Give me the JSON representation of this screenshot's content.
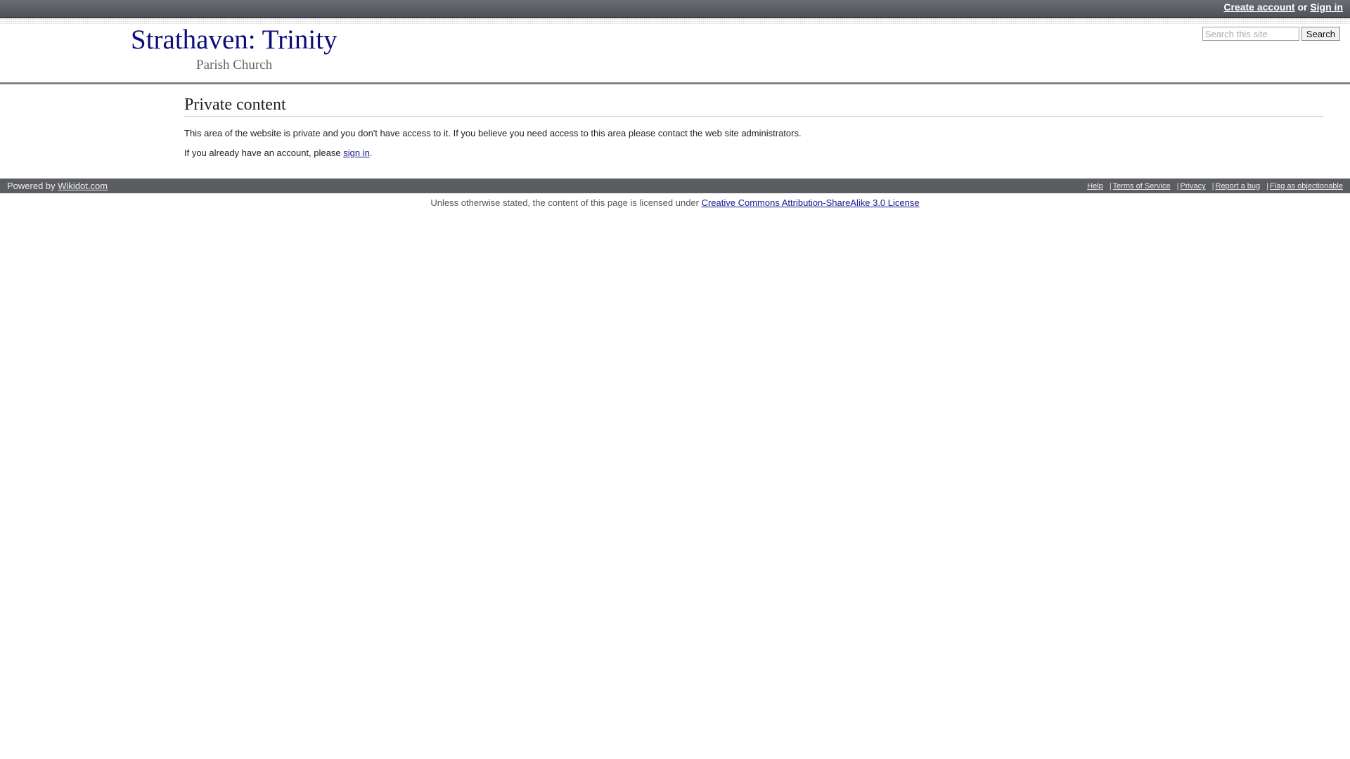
{
  "account": {
    "create_account": "Create account",
    "or_text": "or",
    "sign_in": "Sign in"
  },
  "site": {
    "title": "Strathaven: Trinity",
    "subtitle": "Parish Church"
  },
  "search": {
    "placeholder": "Search this site",
    "value": "",
    "button_label": "Search"
  },
  "page": {
    "title": "Private content",
    "paragraph1": "This area of the website is private and you don't have access to it. If you believe you need access to this area please contact the web site administrators.",
    "paragraph2_prefix": "If you already have an account, please ",
    "paragraph2_link": "sign in",
    "paragraph2_suffix": "."
  },
  "footer": {
    "powered_prefix": "Powered by ",
    "powered_link": "Wikidot.com",
    "links": {
      "help": "Help",
      "terms": "Terms of Service",
      "privacy": "Privacy",
      "report_bug": "Report a bug",
      "flag": "Flag as objectionable"
    },
    "separator": "|"
  },
  "license": {
    "prefix": "Unless otherwise stated, the content of this page is licensed under ",
    "link": "Creative Commons Attribution-ShareAlike 3.0 License"
  }
}
